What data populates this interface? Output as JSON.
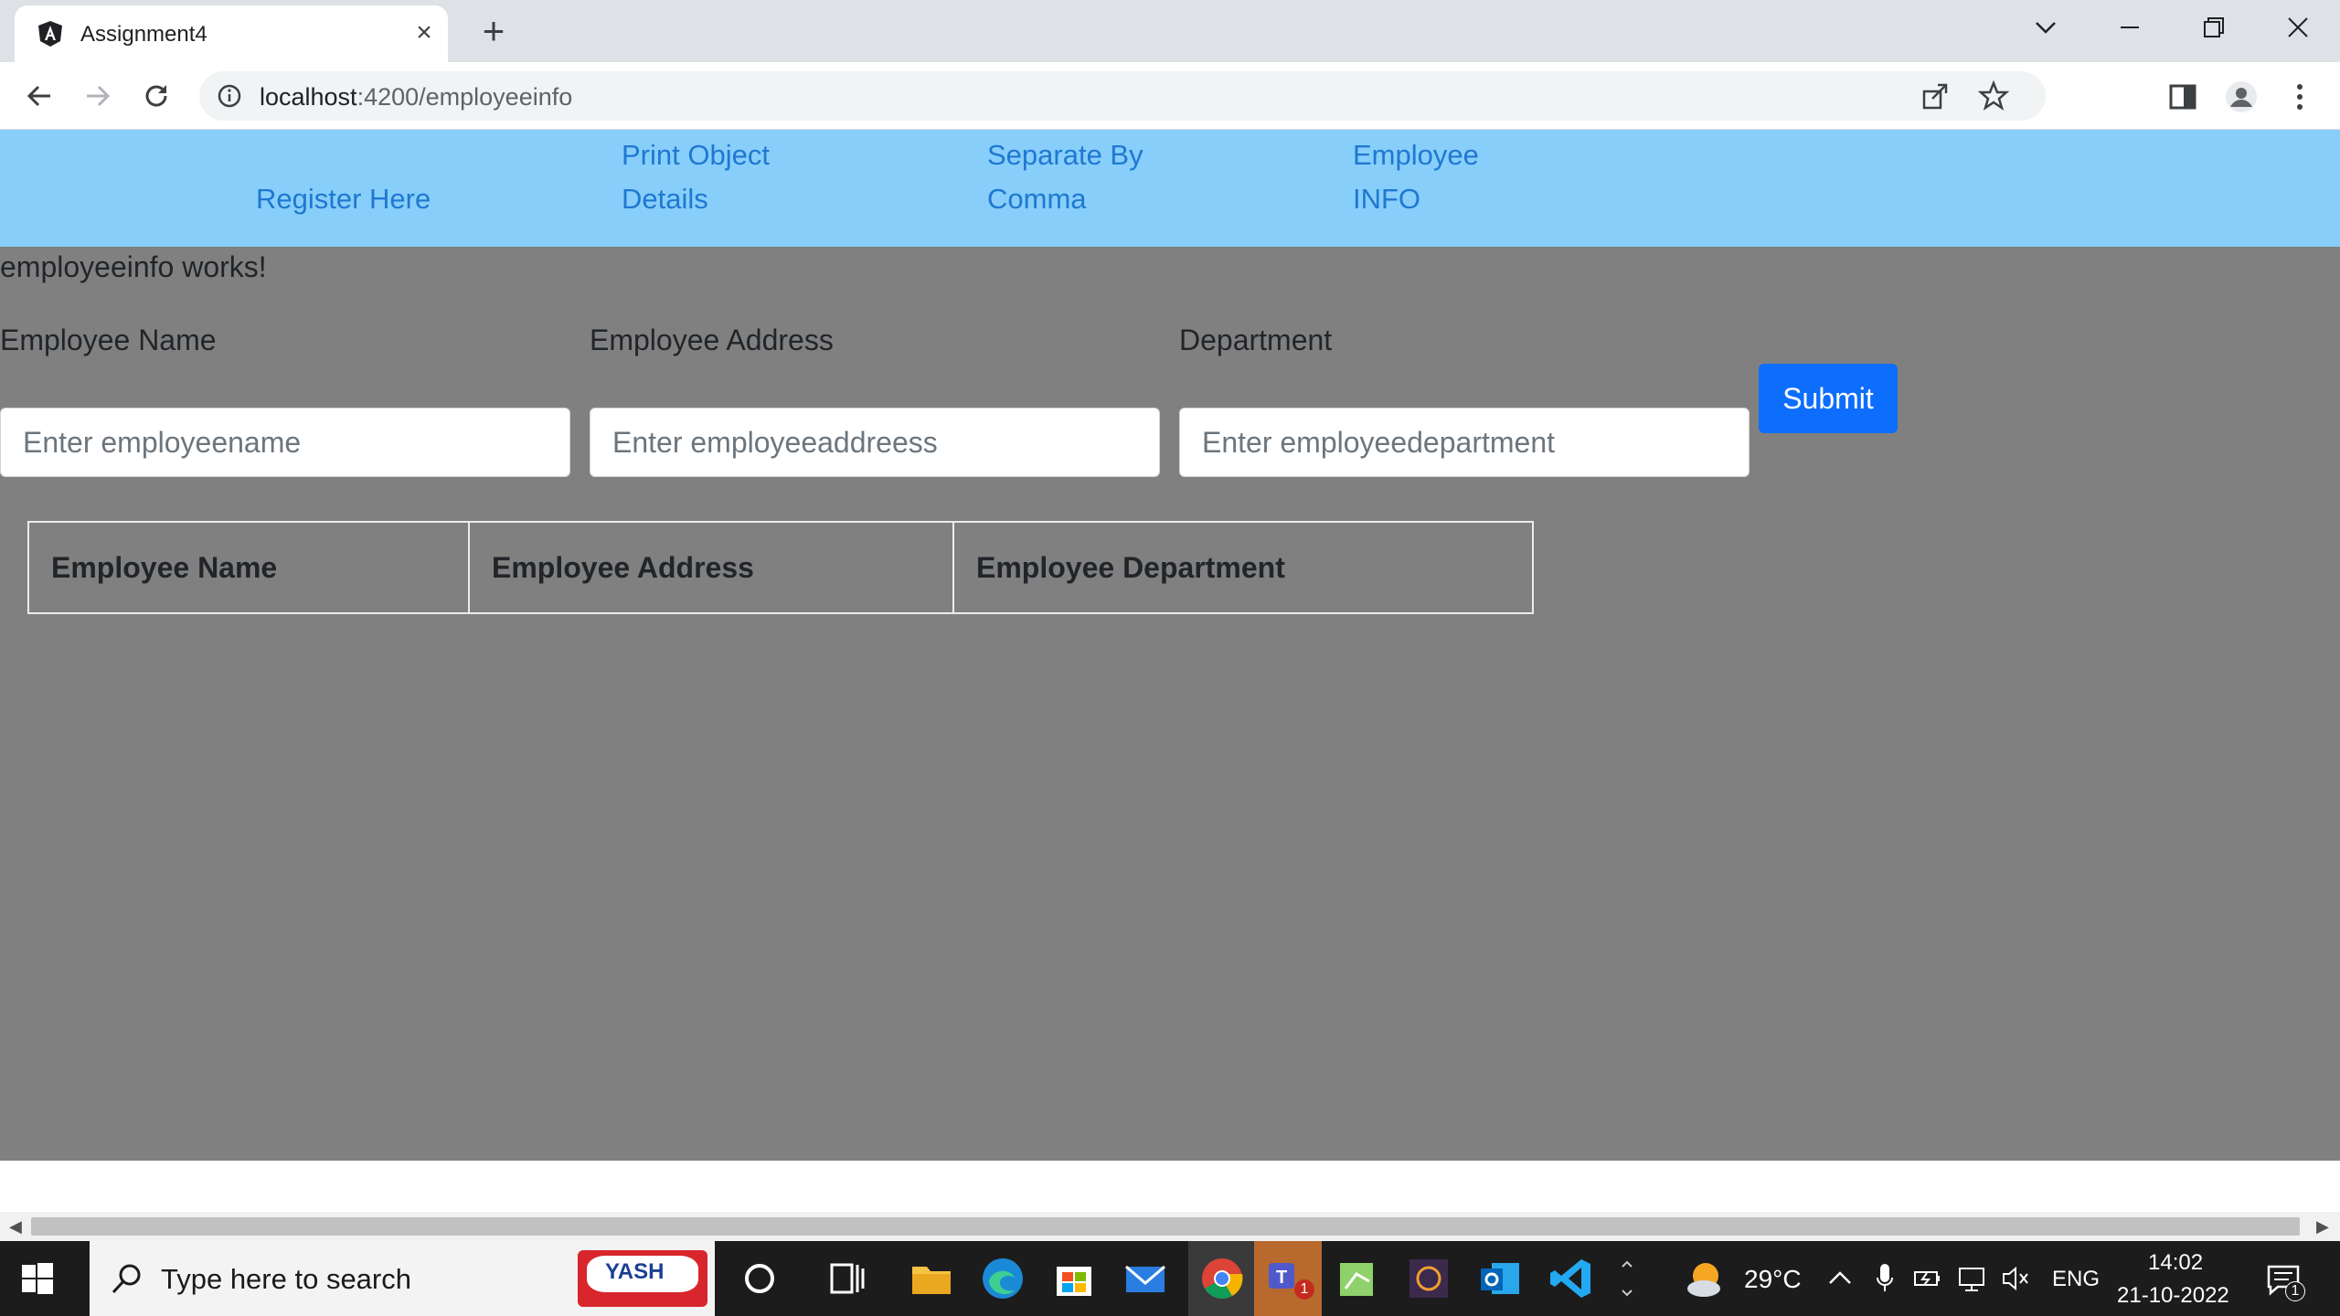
{
  "browser": {
    "tab_title": "Assignment4",
    "url_host": "localhost",
    "url_path": ":4200/employeeinfo"
  },
  "navbar": {
    "links": [
      {
        "line1": "",
        "line2": "Register Here"
      },
      {
        "line1": "Print Object",
        "line2": "Details"
      },
      {
        "line1": "Separate By",
        "line2": "Comma"
      },
      {
        "line1": "Employee",
        "line2": "INFO"
      }
    ]
  },
  "content": {
    "works_text": "employeeinfo works!",
    "form": {
      "name_label": "Employee Name",
      "address_label": "Employee Address",
      "department_label": "Department",
      "name_placeholder": "Enter employeename",
      "address_placeholder": "Enter employeeaddreess",
      "department_placeholder": "Enter employeedepartment",
      "submit_label": "Submit"
    },
    "table": {
      "headers": [
        "Employee Name",
        "Employee Address",
        "Employee Department"
      ]
    }
  },
  "taskbar": {
    "search_placeholder": "Type here to search",
    "search_logo_text": "YASH",
    "weather_temp": "29°C",
    "language": "ENG",
    "time": "14:02",
    "date": "21-10-2022",
    "notification_count": "1",
    "teams_badge": "1"
  },
  "colors": {
    "navbar_bg": "#87cefa",
    "page_bg": "#808080",
    "submit_bg": "#0d6efd",
    "link": "#1f78d1"
  }
}
